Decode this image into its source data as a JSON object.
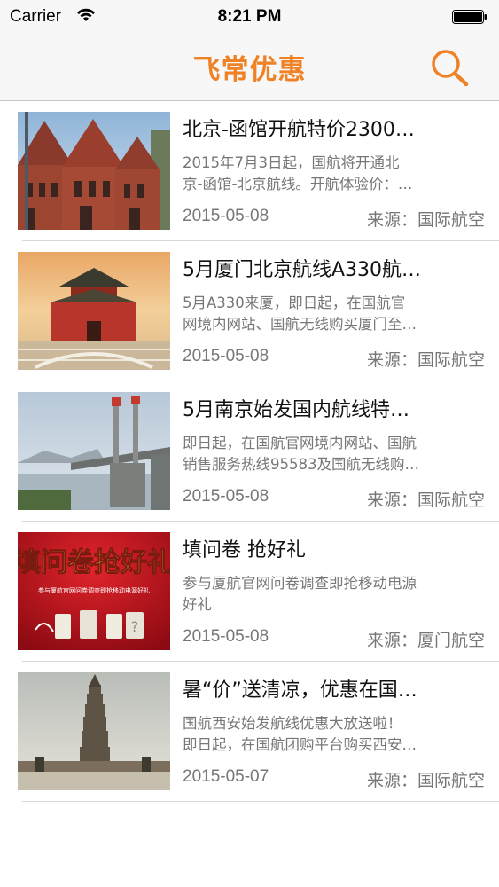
{
  "status_bar": {
    "carrier": "Carrier",
    "time": "8:21 PM"
  },
  "nav": {
    "title": "飞常优惠",
    "search_icon": "search-icon"
  },
  "items": [
    {
      "title": "北京-函馆开航特价2300…",
      "summary_line1": "  2015年7月3日起，国航将开通北",
      "summary_line2": "京-函馆-北京航线。开航体验价：…",
      "date": "2015-05-08",
      "source": "来源：国际航空",
      "image": "brick-buildings-photo"
    },
    {
      "title": "5月厦门北京航线A330航…",
      "summary_line1": "  5月A330来厦，即日起，在国航官",
      "summary_line2": "网境内网站、国航无线购买厦门至…",
      "date": "2015-05-08",
      "source": "来源：国际航空",
      "image": "forbidden-city-gate-photo"
    },
    {
      "title": "5月南京始发国内航线特…",
      "summary_line1": "  即日起，在国航官网境内网站、国航",
      "summary_line2": "销售服务热线95583及国航无线购…",
      "date": "2015-05-08",
      "source": "来源：国际航空",
      "image": "nanjing-bridge-photo"
    },
    {
      "title": "填问卷 抢好礼",
      "summary_line1": "参与厦航官网问卷调查即抢移动电源",
      "summary_line2": "好礼",
      "date": "2015-05-08",
      "source": "来源：厦门航空",
      "image": "survey-promo-banner",
      "banner_text": "填问卷抢好礼",
      "banner_sub": "参与厦航官网问卷调查即抢移动电源好礼"
    },
    {
      "title": "暑“价”送清凉，优惠在国…",
      "summary_line1": "  国航西安始发航线优惠大放送啦！",
      "summary_line2": "即日起，在国航团购平台购买西安…",
      "date": "2015-05-07",
      "source": "来源：国际航空",
      "image": "xian-pagoda-photo"
    }
  ]
}
